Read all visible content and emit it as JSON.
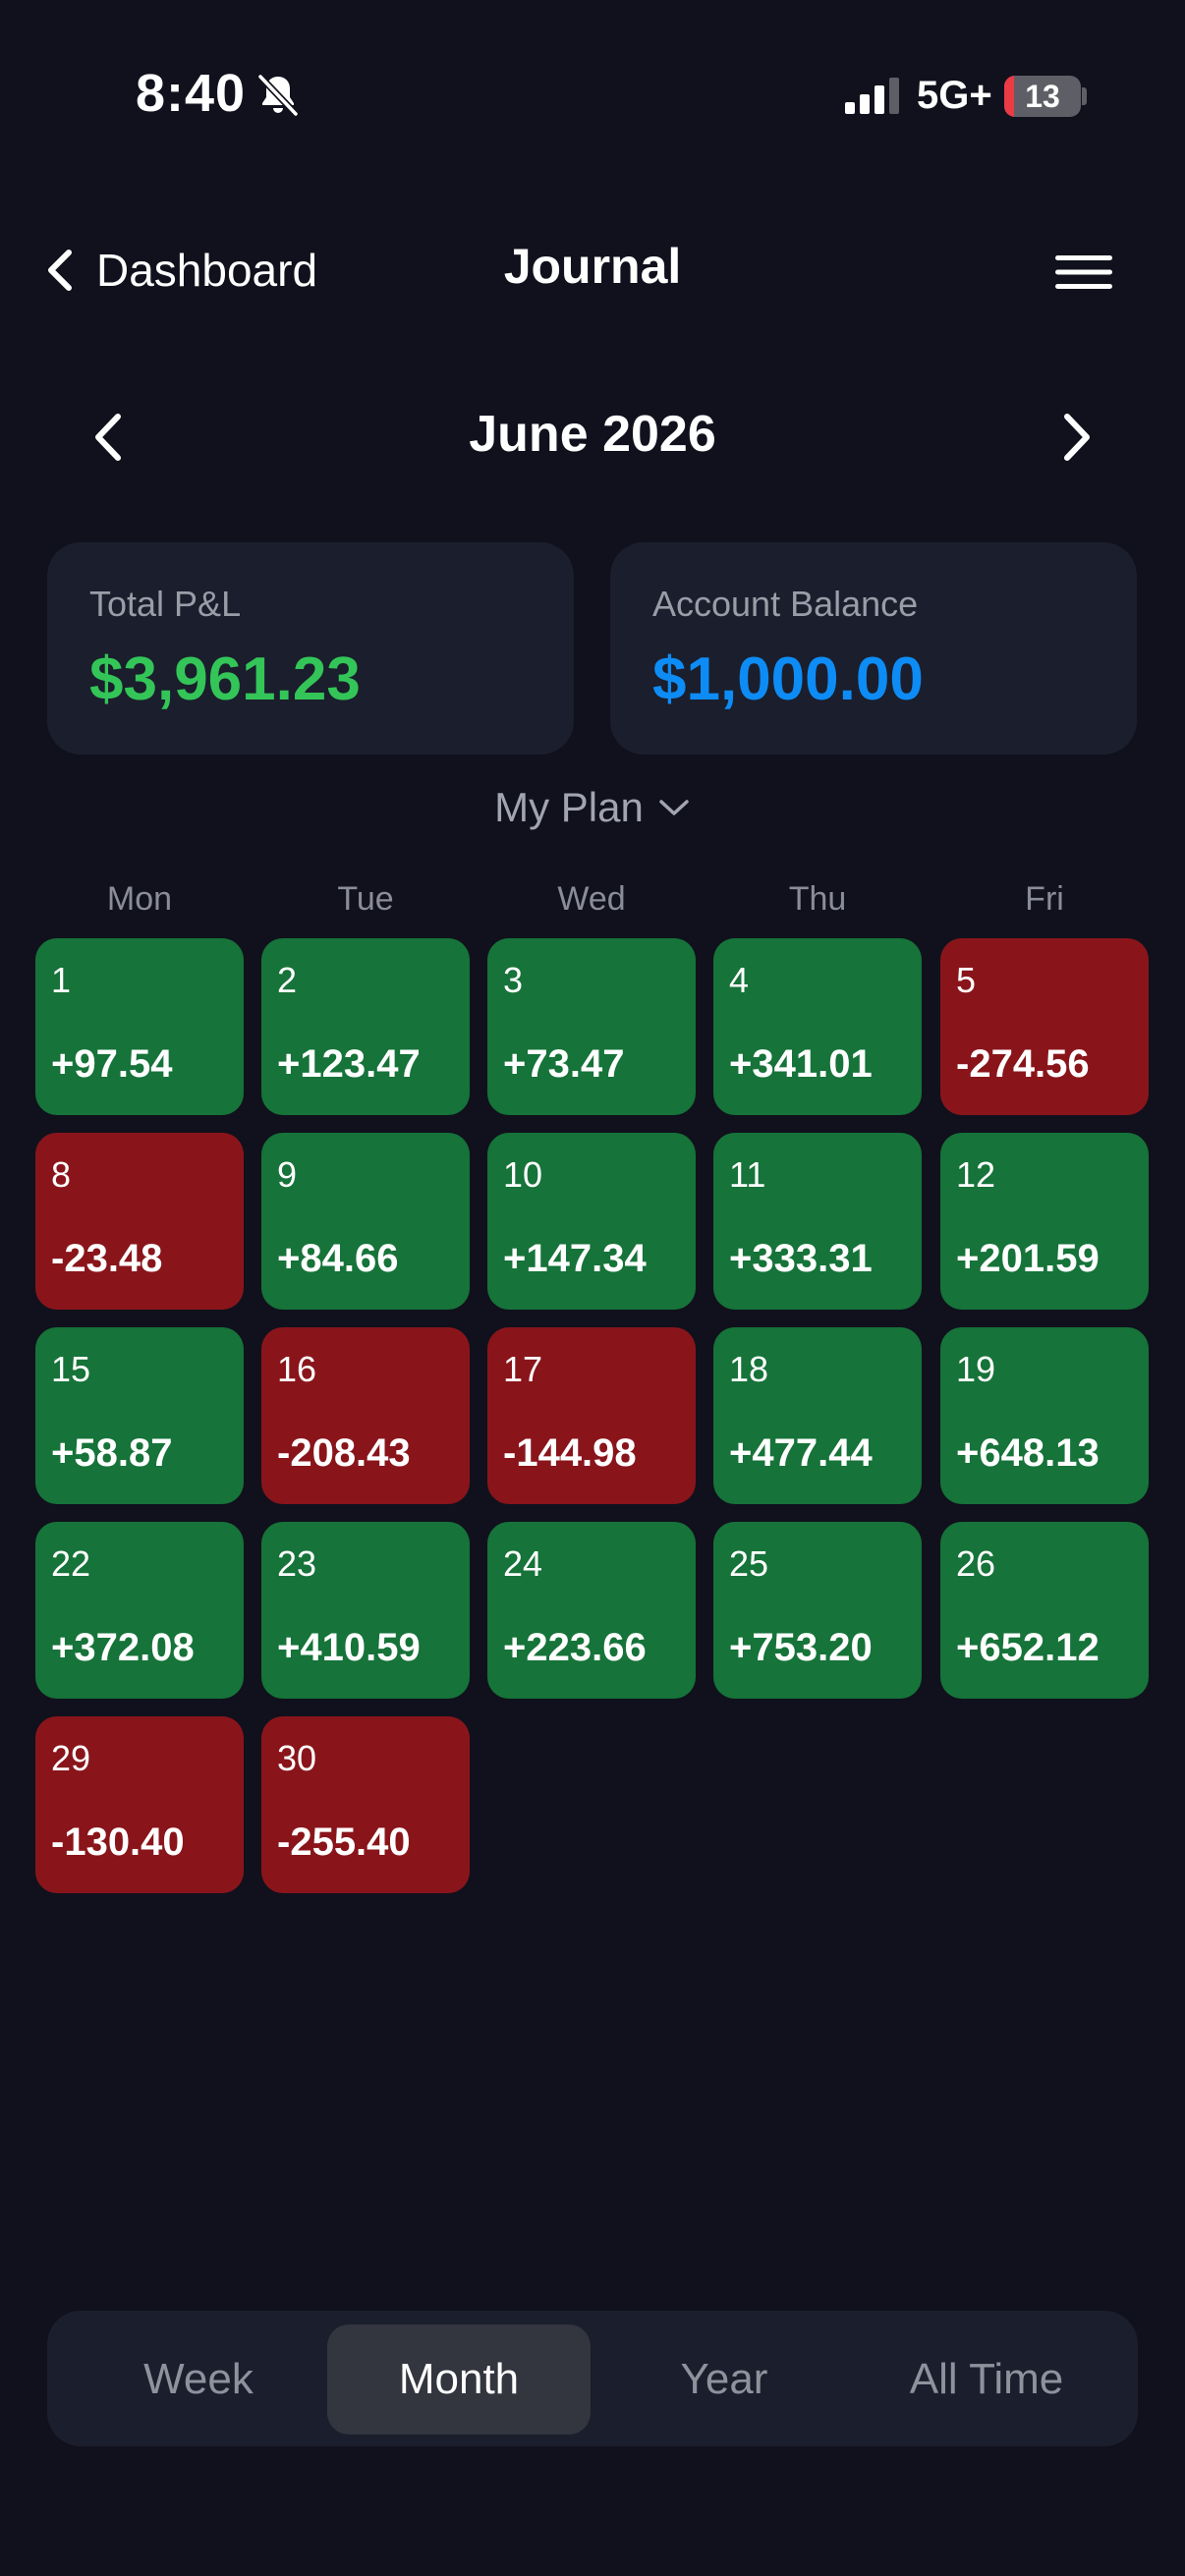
{
  "status_bar": {
    "time": "8:40",
    "network": "5G+",
    "battery": "13",
    "battery_level_percent": 13
  },
  "nav": {
    "back_label": "Dashboard",
    "title": "Journal"
  },
  "month": {
    "title": "June 2026"
  },
  "summary": {
    "pnl_label": "Total P&L",
    "pnl_value": "$3,961.23",
    "balance_label": "Account Balance",
    "balance_value": "$1,000.00"
  },
  "plan": {
    "label": "My Plan"
  },
  "calendar": {
    "weekdays": [
      "Mon",
      "Tue",
      "Wed",
      "Thu",
      "Fri"
    ],
    "days": [
      {
        "day": "1",
        "value": "+97.54",
        "status": "pos"
      },
      {
        "day": "2",
        "value": "+123.47",
        "status": "pos"
      },
      {
        "day": "3",
        "value": "+73.47",
        "status": "pos"
      },
      {
        "day": "4",
        "value": "+341.01",
        "status": "pos"
      },
      {
        "day": "5",
        "value": "-274.56",
        "status": "neg"
      },
      {
        "day": "8",
        "value": "-23.48",
        "status": "neg"
      },
      {
        "day": "9",
        "value": "+84.66",
        "status": "pos"
      },
      {
        "day": "10",
        "value": "+147.34",
        "status": "pos"
      },
      {
        "day": "11",
        "value": "+333.31",
        "status": "pos"
      },
      {
        "day": "12",
        "value": "+201.59",
        "status": "pos"
      },
      {
        "day": "15",
        "value": "+58.87",
        "status": "pos"
      },
      {
        "day": "16",
        "value": "-208.43",
        "status": "neg"
      },
      {
        "day": "17",
        "value": "-144.98",
        "status": "neg"
      },
      {
        "day": "18",
        "value": "+477.44",
        "status": "pos"
      },
      {
        "day": "19",
        "value": "+648.13",
        "status": "pos"
      },
      {
        "day": "22",
        "value": "+372.08",
        "status": "pos"
      },
      {
        "day": "23",
        "value": "+410.59",
        "status": "pos"
      },
      {
        "day": "24",
        "value": "+223.66",
        "status": "pos"
      },
      {
        "day": "25",
        "value": "+753.20",
        "status": "pos"
      },
      {
        "day": "26",
        "value": "+652.12",
        "status": "pos"
      },
      {
        "day": "29",
        "value": "-130.40",
        "status": "neg"
      },
      {
        "day": "30",
        "value": "-255.40",
        "status": "neg"
      }
    ]
  },
  "range_tabs": {
    "tabs": [
      "Week",
      "Month",
      "Year",
      "All Time"
    ],
    "active": "Month"
  },
  "colors": {
    "background": "#10111c",
    "card": "#1b1e2c",
    "positive_cell": "#167339",
    "negative_cell": "#89151b",
    "pnl_text": "#33c558",
    "balance_text": "#0d8cf5"
  },
  "icons": {
    "bell": "bell-slash-icon",
    "signal": "signal-bars-icon",
    "back": "chevron-left-icon",
    "menu": "hamburger-menu-icon",
    "prev": "chevron-left-icon",
    "next": "chevron-right-icon",
    "dropdown": "chevron-down-icon"
  }
}
